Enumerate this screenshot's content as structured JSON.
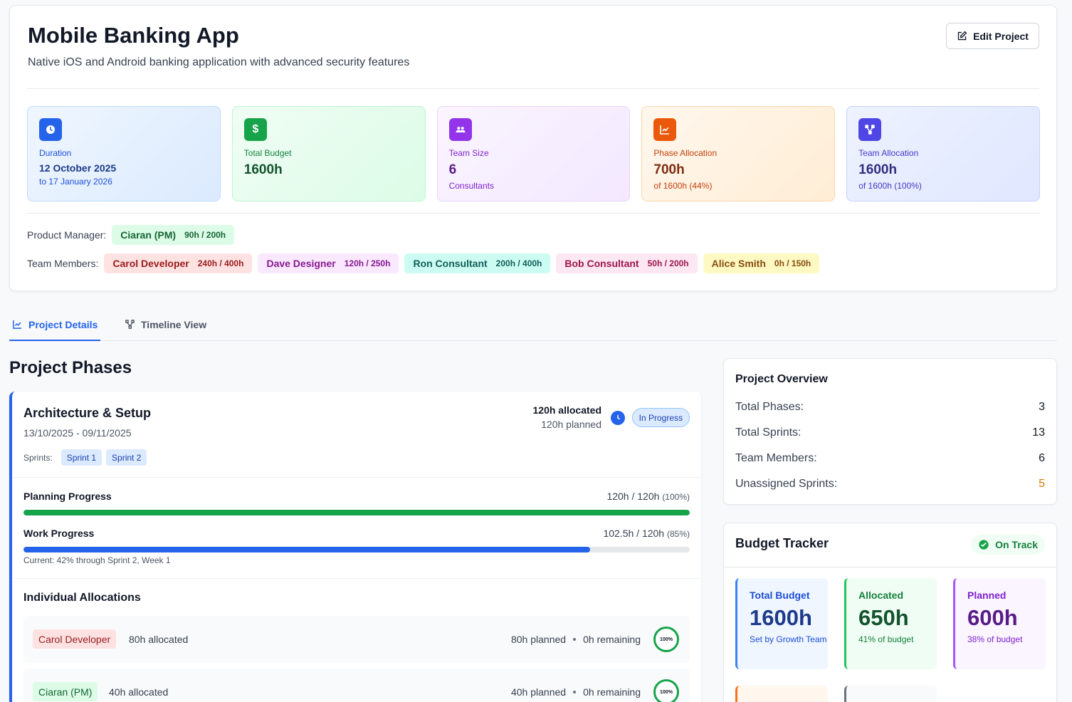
{
  "project": {
    "title": "Mobile Banking App",
    "description": "Native iOS and Android banking application with advanced security features",
    "edit_label": "Edit Project"
  },
  "stats": [
    {
      "label": "Duration",
      "value": "12 October 2025",
      "sub": "to 17 January 2026",
      "icon": "clock-icon",
      "color": "#2563eb"
    },
    {
      "label": "Total Budget",
      "value": "1600h",
      "sub": "",
      "icon": "dollar-icon",
      "color": "#16a34a"
    },
    {
      "label": "Team Size",
      "value": "6",
      "sub": "Consultants",
      "icon": "users-icon",
      "color": "#9333ea"
    },
    {
      "label": "Phase Allocation",
      "value": "700h",
      "sub": "of 1600h (44%)",
      "icon": "chart-icon",
      "color": "#ea580c"
    },
    {
      "label": "Team Allocation",
      "value": "1600h",
      "sub": "of 1600h (100%)",
      "icon": "network-icon",
      "color": "#4f46e5"
    }
  ],
  "product_manager": {
    "label": "Product Manager:",
    "name": "Ciaran (PM)",
    "hours": "90h / 200h"
  },
  "team": {
    "label": "Team Members:",
    "members": [
      {
        "name": "Carol Developer",
        "hours": "240h / 400h"
      },
      {
        "name": "Dave Designer",
        "hours": "120h / 250h"
      },
      {
        "name": "Ron Consultant",
        "hours": "200h / 400h"
      },
      {
        "name": "Bob Consultant",
        "hours": "50h / 200h"
      },
      {
        "name": "Alice Smith",
        "hours": "0h / 150h"
      }
    ]
  },
  "tabs": [
    {
      "label": "Project Details",
      "active": true
    },
    {
      "label": "Timeline View",
      "active": false
    }
  ],
  "phases_title": "Project Phases",
  "phase": {
    "name": "Architecture & Setup",
    "dates": "13/10/2025 - 09/11/2025",
    "sprints_label": "Sprints:",
    "sprints": [
      "Sprint 1",
      "Sprint 2"
    ],
    "allocated": "120h allocated",
    "planned": "120h planned",
    "status": "In Progress",
    "planning": {
      "label": "Planning Progress",
      "value": "120h / 120h",
      "pct": "(100%)",
      "fraction": 1.0
    },
    "work": {
      "label": "Work Progress",
      "value": "102.5h / 120h",
      "pct": "(85%)",
      "fraction": 0.85
    },
    "current": "Current: 42% through Sprint 2, Week 1",
    "individual_title": "Individual Allocations",
    "allocations": [
      {
        "name": "Carol Developer",
        "allocated": "80h allocated",
        "planned": "80h planned",
        "remaining": "0h remaining",
        "ring": "100%"
      },
      {
        "name": "Ciaran (PM)",
        "allocated": "40h allocated",
        "planned": "40h planned",
        "remaining": "0h remaining",
        "ring": "100%"
      }
    ]
  },
  "overview": {
    "title": "Project Overview",
    "rows": [
      {
        "label": "Total Phases:",
        "value": "3"
      },
      {
        "label": "Total Sprints:",
        "value": "13"
      },
      {
        "label": "Team Members:",
        "value": "6"
      },
      {
        "label": "Unassigned Sprints:",
        "value": "5"
      }
    ]
  },
  "budget": {
    "title": "Budget Tracker",
    "status": "On Track",
    "cards": [
      {
        "label": "Total Budget",
        "value": "1600h",
        "sub": "Set by Growth Team"
      },
      {
        "label": "Allocated",
        "value": "650h",
        "sub": "41% of budget"
      },
      {
        "label": "Planned",
        "value": "600h",
        "sub": "38% of budget"
      }
    ]
  },
  "colors": {
    "accent": "#2563eb",
    "success": "#16a34a",
    "warning": "#d97706"
  }
}
